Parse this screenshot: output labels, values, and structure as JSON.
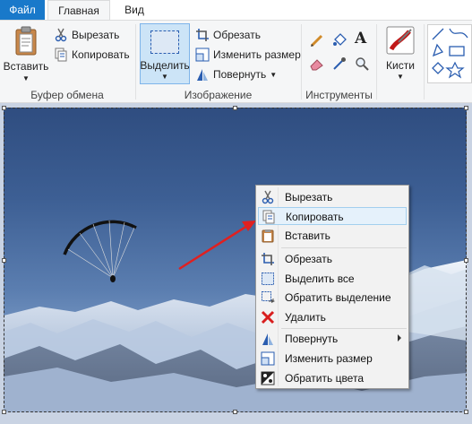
{
  "tabs": {
    "file": "Файл",
    "home": "Главная",
    "view": "Вид"
  },
  "clipboard": {
    "paste": "Вставить",
    "cut": "Вырезать",
    "copy": "Копировать",
    "group": "Буфер обмена"
  },
  "image": {
    "select": "Выделить",
    "crop": "Обрезать",
    "resize": "Изменить размер",
    "rotate": "Повернуть",
    "group": "Изображение"
  },
  "tools": {
    "group": "Инструменты"
  },
  "brushes": {
    "label": "Кисти"
  },
  "context_menu": {
    "items": [
      {
        "label": "Вырезать",
        "icon": "scissors-icon"
      },
      {
        "label": "Копировать",
        "icon": "copy-icon",
        "highlighted": true
      },
      {
        "label": "Вставить",
        "icon": "paste-icon"
      },
      {
        "label": "Обрезать",
        "icon": "crop-icon"
      },
      {
        "label": "Выделить все",
        "icon": "select-all-icon"
      },
      {
        "label": "Обратить выделение",
        "icon": "invert-selection-icon"
      },
      {
        "label": "Удалить",
        "icon": "delete-icon"
      },
      {
        "label": "Повернуть",
        "icon": "rotate-icon",
        "submenu": true
      },
      {
        "label": "Изменить размер",
        "icon": "resize-icon"
      },
      {
        "label": "Обратить цвета",
        "icon": "invert-colors-icon"
      }
    ]
  },
  "colors": {
    "accent": "#1979ca",
    "highlight": "#e5f1fb",
    "arrow": "#e02020"
  }
}
